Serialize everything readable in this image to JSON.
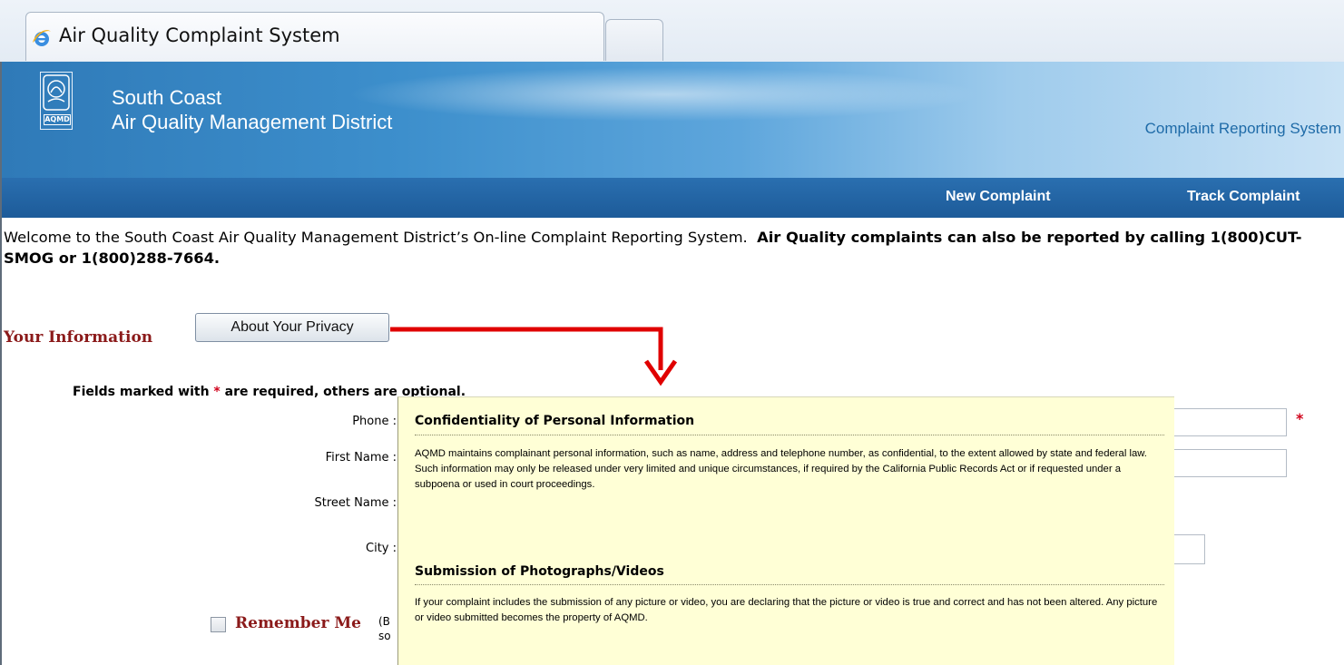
{
  "browser": {
    "tab_title": "Air Quality Complaint System"
  },
  "header": {
    "logo_text": "AQMD",
    "agency_line1": "South Coast",
    "agency_line2": "Air Quality Management District",
    "system_name": "Complaint Reporting System"
  },
  "nav": {
    "new_complaint": "New Complaint",
    "track_complaint": "Track Complaint"
  },
  "welcome": {
    "text": "Welcome to the South Coast Air Quality Management District’s On-line Complaint Reporting System.",
    "bold": "Air Quality complaints can also be reported by calling 1(800)CUT-SMOG or 1(800)288-7664."
  },
  "your_info": {
    "title": "Your Information",
    "privacy_button": "About Your Privacy",
    "required_prefix": "Fields marked with",
    "required_star": "*",
    "required_suffix": "are required, others are optional."
  },
  "form": {
    "phone_label": "Phone :",
    "first_name_label": "First Name :",
    "street_name_label": "Street Name :",
    "city_label": "City :",
    "required_marker": "*",
    "remember_label": "Remember Me",
    "remember_hint_1": "(B",
    "remember_hint_2": "so"
  },
  "popup": {
    "heading1": "Confidentiality of Personal Information",
    "para1": "AQMD maintains complainant personal information, such as name, address and telephone number, as confidential, to the extent allowed by state and federal law. Such information may only be released under very limited and unique circumstances, if required by the California Public Records Act or if requested under a subpoena or used in court proceedings.",
    "heading2": "Submission of Photographs/Videos",
    "para2": "If your complaint includes the submission of any picture or video, you are declaring that the picture or video is true and correct and has not been altered. Any picture or video submitted becomes the property of AQMD."
  },
  "colors": {
    "nav_blue": "#1d5b99",
    "section_red": "#8b1a1a",
    "required_red": "#d0021b",
    "popup_bg": "#ffffd6",
    "callout_red": "#e00000"
  }
}
